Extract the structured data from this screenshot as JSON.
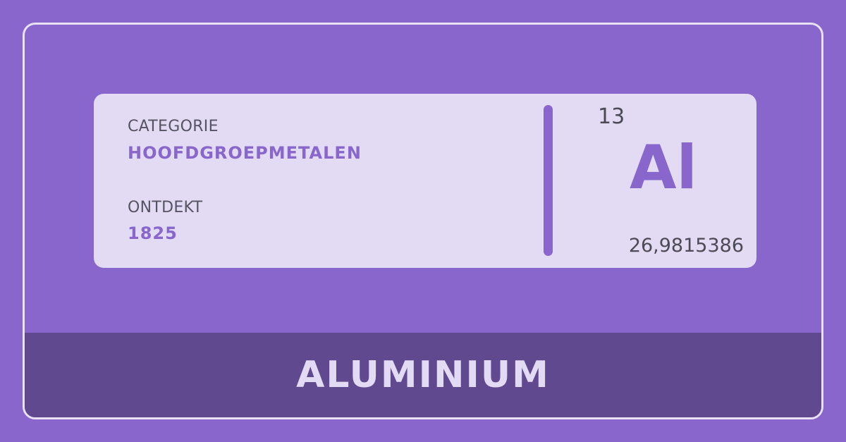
{
  "element": {
    "category_label": "CATEGORIE",
    "category_value": "HOOFDGROEPMETALEN",
    "discovered_label": "ONTDEKT",
    "discovered_value": "1825",
    "atomic_number": "13",
    "symbol": "Al",
    "atomic_mass": "26,9815386",
    "name": "ALUMINIUM"
  },
  "colors": {
    "background": "#8866cc",
    "card": "#e2dbf3",
    "accent": "#8866cc",
    "banner": "#61498f",
    "text_dark": "#4b4a55"
  }
}
